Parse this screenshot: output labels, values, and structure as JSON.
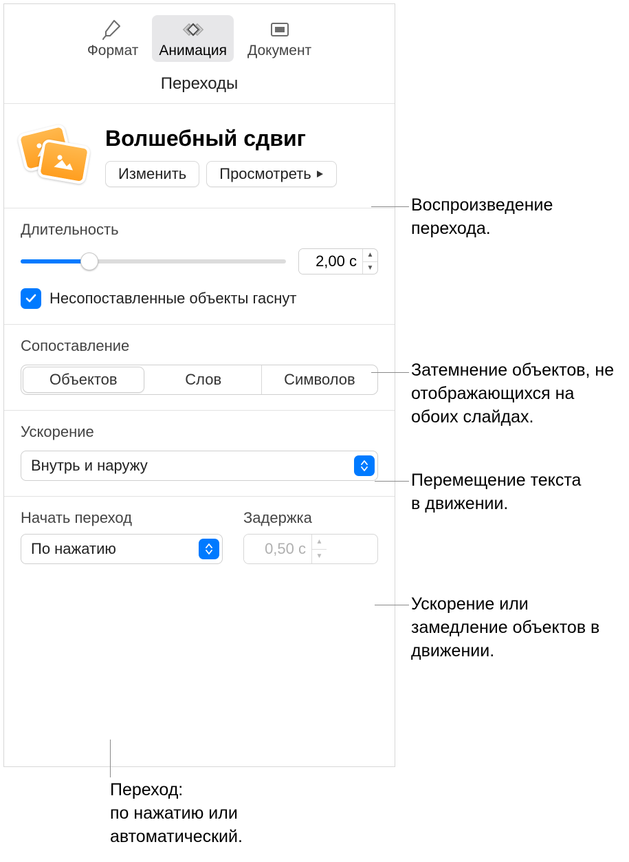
{
  "toolbar": {
    "format": "Формат",
    "animation": "Анимация",
    "document": "Документ"
  },
  "subtab": "Переходы",
  "header": {
    "title": "Волшебный сдвиг",
    "change": "Изменить",
    "preview": "Просмотреть"
  },
  "duration": {
    "label": "Длительность",
    "value": "2,00 с",
    "fade_unmatched_label": "Несопоставленные объекты гаснут"
  },
  "match": {
    "label": "Сопоставление",
    "options": [
      "Объектов",
      "Слов",
      "Символов"
    ]
  },
  "accel": {
    "label": "Ускорение",
    "value": "Внутрь и наружу"
  },
  "start": {
    "label": "Начать переход",
    "value": "По нажатию",
    "delay_label": "Задержка",
    "delay_value": "0,50 с"
  },
  "callouts": {
    "preview": "Воспроизведение перехода.",
    "fade": "Затемнение объектов, не отображающихся на обоих слайдах.",
    "match": "Перемещение текста\nв движении.",
    "accel": "Ускорение или замедление объектов в движении.",
    "start": "Переход:\nпо нажатию или автоматический."
  }
}
